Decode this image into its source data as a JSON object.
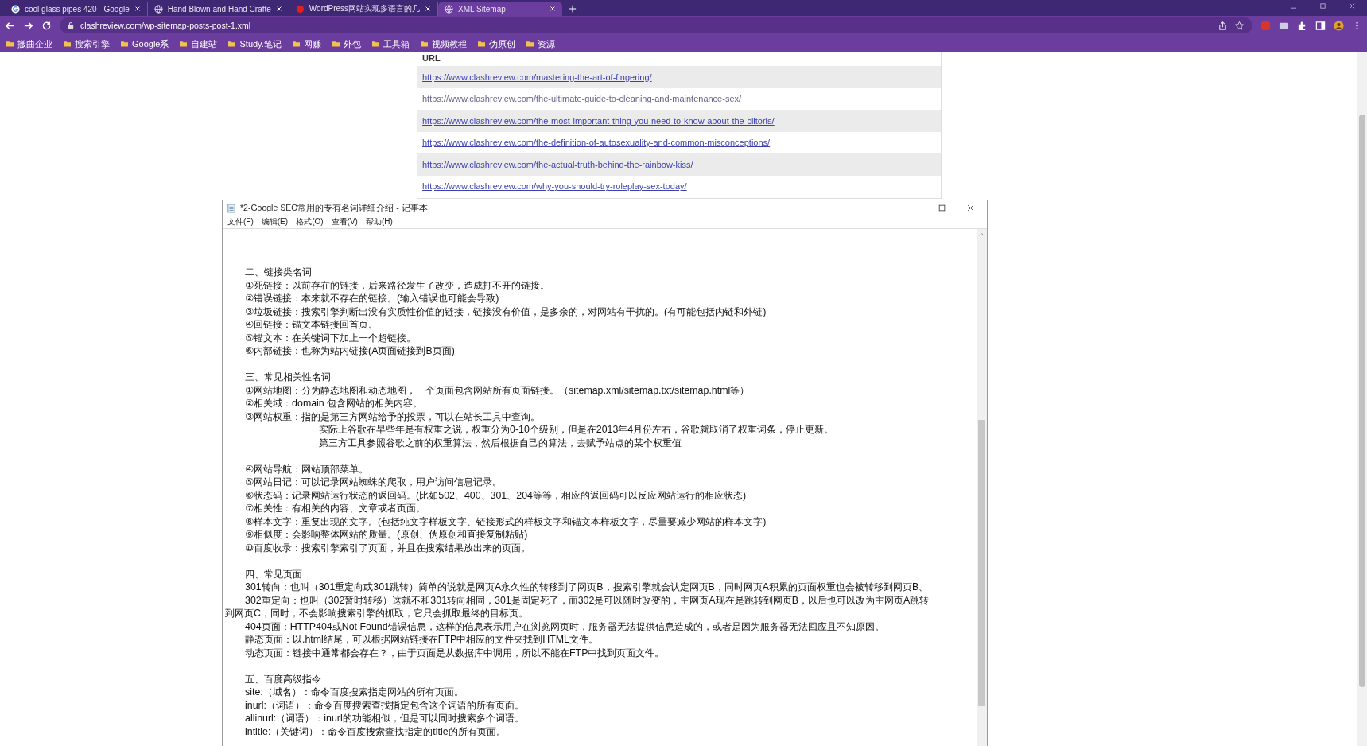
{
  "browser": {
    "tabs": [
      {
        "title": "cool glass pipes 420 - Google",
        "selected": false,
        "kind": "google"
      },
      {
        "title": "Hand Blown and Hand Crafte",
        "selected": false,
        "kind": "globe"
      },
      {
        "title": "WordPress网站实现多语言的几",
        "selected": false,
        "kind": "dot"
      },
      {
        "title": "XML Sitemap",
        "selected": true,
        "kind": "globe"
      }
    ],
    "address": "clashreview.com/wp-sitemap-posts-post-1.xml",
    "bookmarks": [
      "搬曲企业",
      "搜索引擎",
      "Google系",
      "自建站",
      "Study.笔记",
      "网赚",
      "外包",
      "工具箱",
      "视频教程",
      "伪原创",
      "资源"
    ]
  },
  "sitemap": {
    "column": "URL",
    "rows": [
      {
        "url": "https://www.clashreview.com/mastering-the-art-of-fingering/",
        "visited": false
      },
      {
        "url": "https://www.clashreview.com/the-ultimate-guide-to-cleaning-and-maintenance-sex/",
        "visited": true
      },
      {
        "url": "https://www.clashreview.com/the-most-important-thing-you-need-to-know-about-the-clitoris/",
        "visited": false
      },
      {
        "url": "https://www.clashreview.com/the-definition-of-autosexuality-and-common-misconceptions/",
        "visited": false
      },
      {
        "url": "https://www.clashreview.com/the-actual-truth-behind-the-rainbow-kiss/",
        "visited": false
      },
      {
        "url": "https://www.clashreview.com/why-you-should-try-roleplay-sex-today/",
        "visited": false
      }
    ]
  },
  "notepad": {
    "title": "*2-Google SEO常用的专有名词详细介绍 - 记事本",
    "menu": [
      "文件(F)",
      "编辑(E)",
      "格式(O)",
      "查看(V)",
      "帮助(H)"
    ],
    "lines": [
      {
        "kind": "normal",
        "text": "二、链接类名词"
      },
      {
        "kind": "normal",
        "text": "①死链接：以前存在的链接，后来路径发生了改变，造成打不开的链接。"
      },
      {
        "kind": "normal",
        "text": "②错误链接：本来就不存在的链接。(输入错误也可能会导致)"
      },
      {
        "kind": "normal",
        "text": "③垃圾链接：搜索引擎判断出没有实质性价值的链接，链接没有价值，是多余的，对网站有干扰的。(有可能包括内链和外链)"
      },
      {
        "kind": "normal",
        "text": "④回链接：锚文本链接回首页。"
      },
      {
        "kind": "normal",
        "text": "⑤锚文本：在关键词下加上一个超链接。"
      },
      {
        "kind": "normal",
        "text": "⑥内部链接：也称为站内链接(A页面链接到B页面)"
      },
      {
        "kind": "blank"
      },
      {
        "kind": "normal",
        "text": "三、常见相关性名词"
      },
      {
        "kind": "normal",
        "text": "①网站地图：分为静态地图和动态地图，一个页面包含网站所有页面链接。（sitemap.xml/sitemap.txt/sitemap.html等）"
      },
      {
        "kind": "normal",
        "text": "②相关域：domain 包含网站的相关内容。"
      },
      {
        "kind": "normal",
        "text": "③网站权重：指的是第三方网站给予的投票，可以在站长工具中查询。"
      },
      {
        "kind": "deep",
        "text": "实际上谷歌在早些年是有权重之说，权重分为0-10个级别，但是在2013年4月份左右，谷歌就取消了权重词条，停止更新。"
      },
      {
        "kind": "deep",
        "text": "第三方工具参照谷歌之前的权重算法，然后根据自己的算法，去赋予站点的某个权重值"
      },
      {
        "kind": "blank"
      },
      {
        "kind": "normal",
        "text": "④网站导航：网站顶部菜单。"
      },
      {
        "kind": "normal",
        "text": "⑤网站日记：可以记录网站蜘蛛的爬取，用户访问信息记录。"
      },
      {
        "kind": "normal",
        "text": "⑥状态码：记录网站运行状态的返回码。(比如502、400、301、204等等，相应的返回码可以反应网站运行的相应状态)"
      },
      {
        "kind": "normal",
        "text": "⑦相关性：有相关的内容、文章或者页面。"
      },
      {
        "kind": "normal",
        "text": "⑧样本文字：重复出现的文字。(包括纯文字样板文字、链接形式的样板文字和锚文本样板文字，尽量要减少网站的样本文字)"
      },
      {
        "kind": "normal",
        "text": "⑨相似度：会影响整体网站的质量。(原创、伪原创和直接复制粘贴)"
      },
      {
        "kind": "normal",
        "text": "⑩百度收录：搜索引擎索引了页面，并且在搜索结果放出来的页面。"
      },
      {
        "kind": "blank"
      },
      {
        "kind": "normal",
        "text": "四、常见页面"
      },
      {
        "kind": "inset",
        "text": "301转向：也叫（301重定向或301跳转）简单的说就是网页A永久性的转移到了网页B，搜索引擎就会认定网页B，同时网页A积累的页面权重也会被转移到网页B、"
      },
      {
        "kind": "inset",
        "text": "302重定向：也叫（302暂时转移）这就不和301转向相同，301是固定死了，而302是可以随时改变的，主网页A现在是跳转到网页B，以后也可以改为主网页A跳转"
      },
      {
        "kind": "wrap",
        "text": "到网页C，同时，不会影响搜索引擎的抓取，它只会抓取最终的目标页。"
      },
      {
        "kind": "inset",
        "text": "404页面：HTTP404或Not Found错误信息，这样的信息表示用户在浏览网页时，服务器无法提供信息造成的，或者是因为服务器无法回应且不知原因。"
      },
      {
        "kind": "inset",
        "text": "静态页面：以.html结尾，可以根据网站链接在FTP中相应的文件夹找到HTML文件。"
      },
      {
        "kind": "inset",
        "text": "动态页面：链接中通常都会存在？，由于页面是从数据库中调用，所以不能在FTP中找到页面文件。"
      },
      {
        "kind": "blank"
      },
      {
        "kind": "normal",
        "text": "五、百度高级指令"
      },
      {
        "kind": "normal",
        "text": "site:（域名）：命令百度搜索指定网站的所有页面。"
      },
      {
        "kind": "normal",
        "text": "inurl:（词语）：命令百度搜索查找指定包含这个词语的所有页面。"
      },
      {
        "kind": "normal",
        "text": "allinurl:（词语）：inurl的功能相似，但是可以同时搜索多个词语。"
      },
      {
        "kind": "normal",
        "text": "intitle:（关键词）：命令百度搜索查找指定的title的所有页面。"
      }
    ]
  }
}
